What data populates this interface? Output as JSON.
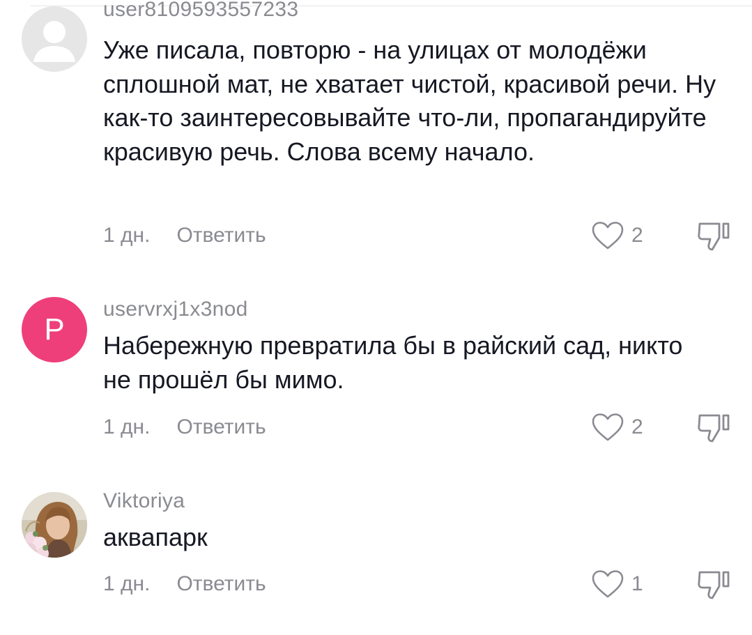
{
  "comments": [
    {
      "username": "user8109593557233",
      "text": "Уже писала, повторю - на улицах от молодёжи сплошной мат, не хватает чистой, красивой речи. Ну как-то заинтересовывайте что-ли, пропагандируйте красивую речь. Слова всему начало.",
      "time": "1 дн.",
      "reply_label": "Ответить",
      "likes": "2",
      "avatar": {
        "type": "default"
      }
    },
    {
      "username": "uservrxj1x3nod",
      "text": "Набережную превратила бы в райский сад, никто не прошёл бы мимо.",
      "time": "1 дн.",
      "reply_label": "Ответить",
      "likes": "2",
      "avatar": {
        "type": "letter",
        "letter": "P",
        "color": "#ee3f7a"
      }
    },
    {
      "username": "Viktoriya",
      "text": "аквапарк",
      "time": "1 дн.",
      "reply_label": "Ответить",
      "likes": "1",
      "avatar": {
        "type": "photo"
      }
    }
  ],
  "icons": {
    "like": "heart-outline-icon",
    "dislike": "thumbs-down-outline-icon"
  },
  "colors": {
    "text": "#161823",
    "secondary": "#8a8b91",
    "letter_avatar_bg": "#ee3f7a",
    "default_avatar_bg": "#e6e6e6"
  }
}
